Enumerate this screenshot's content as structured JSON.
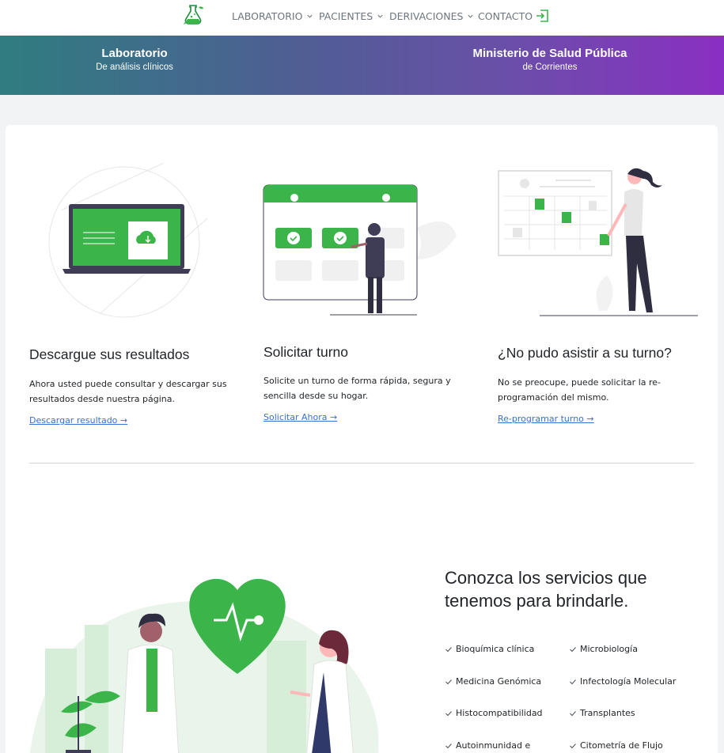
{
  "nav": {
    "logo_icon": "flask-leaf-logo",
    "items": [
      {
        "label": "LABORATORIO",
        "has_dropdown": true
      },
      {
        "label": "PACIENTES",
        "has_dropdown": true
      },
      {
        "label": "DERIVACIONES",
        "has_dropdown": true
      },
      {
        "label": "CONTACTO",
        "has_dropdown": false
      }
    ],
    "login_icon": "login-icon"
  },
  "banner": {
    "left_title": "Laboratorio",
    "left_subtitle": "De análisis clínicos",
    "right_title": "Ministerio de Salud Pública",
    "right_subtitle": "de Corrientes"
  },
  "features": [
    {
      "title": "Descargue sus resultados",
      "text": "Ahora usted puede consultar y descargar sus resultados desde nuestra página.",
      "link": "Descargar resultado "
    },
    {
      "title": "Solicitar turno",
      "text": "Solicite un turno de forma rápida, segura y sencilla desde su hogar.",
      "link": "Solicitar Ahora "
    },
    {
      "title": "¿No pudo asistir a su turno?",
      "text": "No se preocupe, puede solicitar la re-programación del mismo.",
      "link": "Re-programar turno "
    }
  ],
  "services": {
    "title": "Conozca los servicios que tenemos para brindarle.",
    "items": [
      "Bioquímica clínica",
      "Microbiología",
      "Medicina Genómica",
      "Infectología Molecular",
      "Histocompatibilidad",
      "Transplantes",
      "Autoinmunidad e",
      "Citometría de Flujo"
    ]
  },
  "colors": {
    "accent_green": "#3bb54a",
    "link_blue": "#3b6fd1",
    "banner_start": "#2f7d80",
    "banner_end": "#8a2fc3"
  }
}
